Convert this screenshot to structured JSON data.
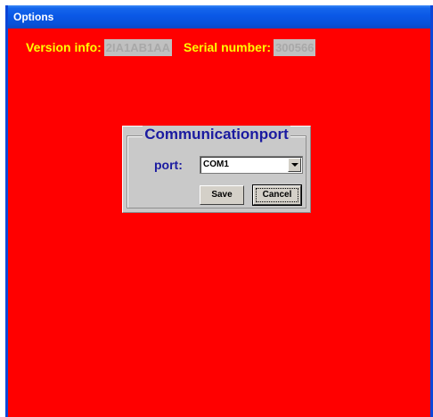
{
  "window": {
    "title": "Options"
  },
  "info": {
    "version_label": "Version info:",
    "version_value": "2IA1AB1AA",
    "serial_label": "Serial number:",
    "serial_value": "300566"
  },
  "comm": {
    "group_title": "Communicationport",
    "port_label": "port:",
    "port_value": "COM1",
    "save_label": "Save",
    "cancel_label": "Cancel"
  },
  "colors": {
    "client_background": "#ff0000",
    "label_text": "#ffff00",
    "title_bar": "#0a58e6",
    "group_text": "#1a1aa0"
  }
}
